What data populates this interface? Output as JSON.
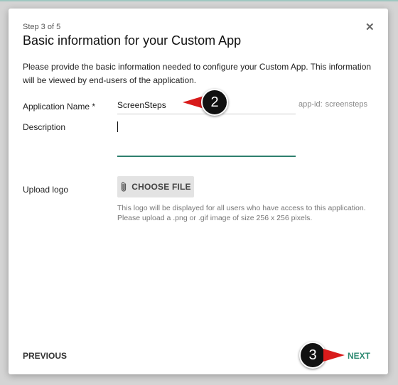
{
  "dialog": {
    "step": "Step 3 of 5",
    "title": "Basic information for your Custom App",
    "close_icon": "close-icon",
    "close_glyph": "✕",
    "description": "Please provide the basic information needed to configure your Custom App. This information will be viewed by end-users of the application."
  },
  "form": {
    "name_label": "Application Name *",
    "name_value": "ScreenSteps",
    "app_id_prefix": "app-id:",
    "app_id_value": "screensteps",
    "description_label": "Description",
    "description_value": "",
    "logo_label": "Upload logo",
    "choose_file_label": "CHOOSE FILE",
    "choose_file_icon": "paperclip-icon",
    "logo_help_line1": "This logo will be displayed for all users who have access to this application.",
    "logo_help_line2": "Please upload a .png or .gif image of size 256 x 256 pixels."
  },
  "footer": {
    "previous_label": "PREVIOUS",
    "next_label": "NEXT"
  },
  "callouts": [
    {
      "number": "2",
      "arrow": "left-arrow-icon"
    },
    {
      "number": "3",
      "arrow": "right-arrow-icon"
    }
  ],
  "colors": {
    "accent": "#2e8a72",
    "underline_active": "#2e7f6e",
    "callout_arrow": "#d81b1b",
    "callout_badge": "#111111"
  }
}
